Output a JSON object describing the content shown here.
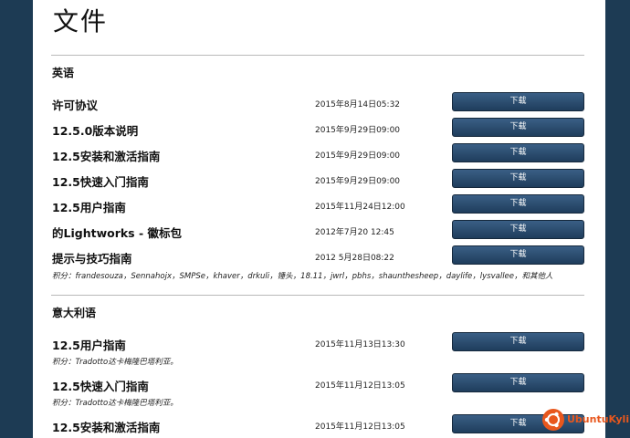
{
  "page_title": "文件",
  "sections": [
    {
      "title": "英语",
      "docs": [
        {
          "name": "许可协议",
          "date": "2015年8月14日05:32",
          "button": "下载"
        },
        {
          "name": "12.5.0版本说明",
          "date": "2015年9月29日09:00",
          "button": "下载"
        },
        {
          "name": "12.5安装和激活指南",
          "date": "2015年9月29日09:00",
          "button": "下载"
        },
        {
          "name": "12.5快速入门指南",
          "date": "2015年9月29日09:00",
          "button": "下载"
        },
        {
          "name": "12.5用户指南",
          "date": "2015年11月24日12:00",
          "button": "下载"
        },
        {
          "name": "的Lightworks - 徽标包",
          "date": "2012年7月20 12:45",
          "button": "下载"
        },
        {
          "name": "提示与技巧指南",
          "date": "2012 5月28日08:22",
          "button": "下载",
          "credit": "积分：frandesouza，Sennahojx，SMPSe，khaver，drkuli，锤头，18.11，jwrl，pbhs，shaunthesheep，daylife，lysvallee，和其他人"
        }
      ]
    },
    {
      "title": "意大利语",
      "docs": [
        {
          "name": "12.5用户指南",
          "date": "2015年11月13日13:30",
          "button": "下载",
          "credit": "积分：Tradotto达卡梅隆巴塔利亚。"
        },
        {
          "name": "12.5快速入门指南",
          "date": "2015年11月12日13:05",
          "button": "下载",
          "credit": "积分：Tradotto达卡梅隆巴塔利亚。"
        },
        {
          "name": "12.5安装和激活指南",
          "date": "2015年11月12日13:05",
          "button": "下载"
        }
      ]
    }
  ],
  "watermark": {
    "text": "UbuntuKylin",
    "icon": "ubuntu-logo-icon",
    "color": "#e8571d"
  },
  "colors": {
    "side_bg": "#1d3b54",
    "button_top": "#3a5f85",
    "button_bottom": "#1f3d5c"
  }
}
